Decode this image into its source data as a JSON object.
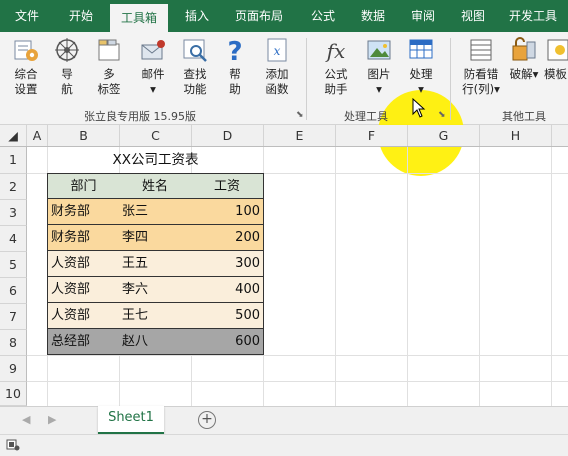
{
  "tabs": [
    "文件",
    "开始",
    "工具箱",
    "插入",
    "页面布局",
    "公式",
    "数据",
    "审阅",
    "视图",
    "开发工具"
  ],
  "ribbon": {
    "buttons": [
      {
        "label1": "综合",
        "label2": "设置",
        "icon": "settings-gear-icon"
      },
      {
        "label1": "导",
        "label2": "航",
        "icon": "compass-icon"
      },
      {
        "label1": "多",
        "label2": "标签",
        "icon": "tabs-icon"
      },
      {
        "label1": "邮件",
        "label2": "▾",
        "icon": "mail-icon"
      },
      {
        "label1": "查找",
        "label2": "功能",
        "icon": "search-function-icon"
      },
      {
        "label1": "帮",
        "label2": "助",
        "icon": "help-icon"
      },
      {
        "label1": "添加",
        "label2": "函数",
        "icon": "add-function-icon"
      },
      {
        "label1": "公式",
        "label2": "助手",
        "icon": "fx-icon"
      },
      {
        "label1": "图片",
        "label2": "▾",
        "icon": "picture-icon"
      },
      {
        "label1": "处理",
        "label2": "▾",
        "icon": "table-process-icon"
      },
      {
        "label1": "防看错",
        "label2": "行(列)▾",
        "icon": "grid-guard-icon"
      },
      {
        "label1": "",
        "label2": "破解▾",
        "icon": "unlock-icon"
      },
      {
        "label1": "",
        "label2": "模板",
        "icon": "template-icon"
      }
    ],
    "groups": [
      "张立良专用版 15.95版",
      "处理工具",
      "其他工具"
    ]
  },
  "columns": [
    "A",
    "B",
    "C",
    "D",
    "E",
    "F",
    "G",
    "H"
  ],
  "rows": [
    "1",
    "2",
    "3",
    "4",
    "5",
    "6",
    "7",
    "8",
    "9",
    "10"
  ],
  "table": {
    "title": "XX公司工资表",
    "headers": [
      "部门",
      "姓名",
      "工资"
    ],
    "rows": [
      {
        "dept": "财务部",
        "name": "张三",
        "salary": "100",
        "color": "#fad99e"
      },
      {
        "dept": "财务部",
        "name": "李四",
        "salary": "200",
        "color": "#fad99e"
      },
      {
        "dept": "人资部",
        "name": "王五",
        "salary": "300",
        "color": "#faeedb"
      },
      {
        "dept": "人资部",
        "name": "李六",
        "salary": "400",
        "color": "#faeedb"
      },
      {
        "dept": "人资部",
        "name": "王七",
        "salary": "500",
        "color": "#faeedb"
      },
      {
        "dept": "总经部",
        "name": "赵八",
        "salary": "600",
        "color": "#a6a6a6"
      }
    ]
  },
  "sheet": {
    "name": "Sheet1",
    "add": "+"
  },
  "colors": {
    "accent": "#217346",
    "header_fill": "#d9e4d5"
  }
}
